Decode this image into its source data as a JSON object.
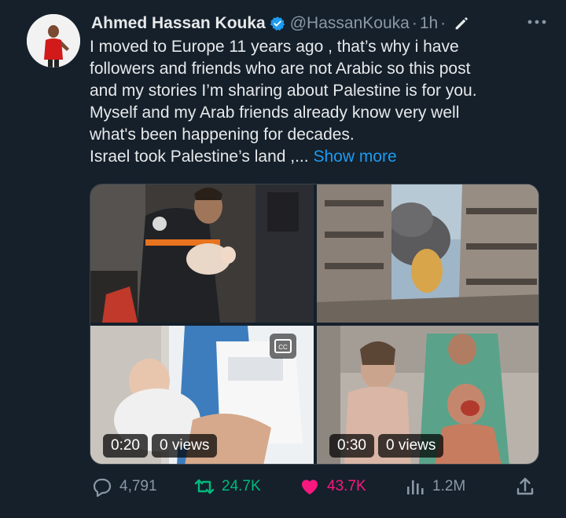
{
  "author": {
    "display_name": "Ahmed Hassan Kouka",
    "handle": "@HassanKouka",
    "separator": "·",
    "time": "1h",
    "separator2": "·"
  },
  "icons": {
    "verified": "verified-badge-icon",
    "edit": "edit-pencil-icon",
    "more": "more-dots-icon",
    "reply": "reply-bubble-icon",
    "retweet": "retweet-icon",
    "like": "heart-icon",
    "views": "views-bar-chart-icon",
    "share": "share-upload-icon",
    "captions": "closed-captions-icon"
  },
  "colors": {
    "background": "#15202b",
    "accent": "#1d9bf0",
    "retweet": "#00ba7c",
    "like": "#f91880",
    "muted": "#8b98a5"
  },
  "tweet": {
    "lines": [
      "I moved to Europe 11 years ago , that’s why i have",
      "followers and friends who are not Arabic so this post",
      "and my stories I’m sharing about Palestine is for you.",
      " Myself and my Arab friends already know very well",
      "what's been happening for decades.",
      "Israel took Palestine’s land ,..."
    ],
    "show_more": "Show more"
  },
  "media": [
    {
      "type": "photo"
    },
    {
      "type": "photo"
    },
    {
      "type": "video",
      "duration": "0:20",
      "views": "0 views"
    },
    {
      "type": "video",
      "duration": "0:30",
      "views": "0 views"
    }
  ],
  "actions": {
    "replies": "4,791",
    "retweets": "24.7K",
    "likes": "43.7K",
    "views": "1.2M"
  }
}
